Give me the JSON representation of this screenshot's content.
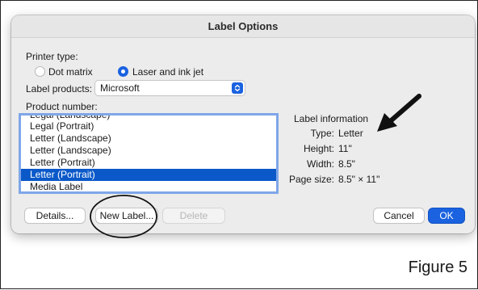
{
  "dialog": {
    "title": "Label Options",
    "printer_type_label": "Printer type:",
    "printer_types": [
      {
        "label": "Dot matrix",
        "selected": false
      },
      {
        "label": "Laser and ink jet",
        "selected": true
      }
    ],
    "label_products_label": "Label products:",
    "label_products_value": "Microsoft",
    "product_number_label": "Product number:",
    "products": [
      {
        "label": "Legal (Landscape)",
        "selected": false
      },
      {
        "label": "Legal (Portrait)",
        "selected": false
      },
      {
        "label": "Letter (Landscape)",
        "selected": false
      },
      {
        "label": "Letter (Landscape)",
        "selected": false
      },
      {
        "label": "Letter (Portrait)",
        "selected": false
      },
      {
        "label": "Letter (Portrait)",
        "selected": true
      },
      {
        "label": "Media Label",
        "selected": false
      }
    ],
    "info": {
      "heading": "Label information",
      "type_label": "Type:",
      "type_value": "Letter",
      "height_label": "Height:",
      "height_value": "11\"",
      "width_label": "Width:",
      "width_value": "8.5\"",
      "page_size_label": "Page size:",
      "page_size_value": "8.5\" × 11\""
    },
    "buttons": {
      "details": "Details...",
      "new_label": "New Label...",
      "delete": "Delete",
      "cancel": "Cancel",
      "ok": "OK"
    }
  },
  "figure_caption": "Figure 5",
  "colors": {
    "accent": "#1a62e0",
    "selection": "#0b59c9",
    "list_focus_ring": "#7fa6e8"
  },
  "annotations": {
    "arrow": "black-arrow-pointing-at-type-letter",
    "circle": "ellipse-around-new-label-button"
  }
}
